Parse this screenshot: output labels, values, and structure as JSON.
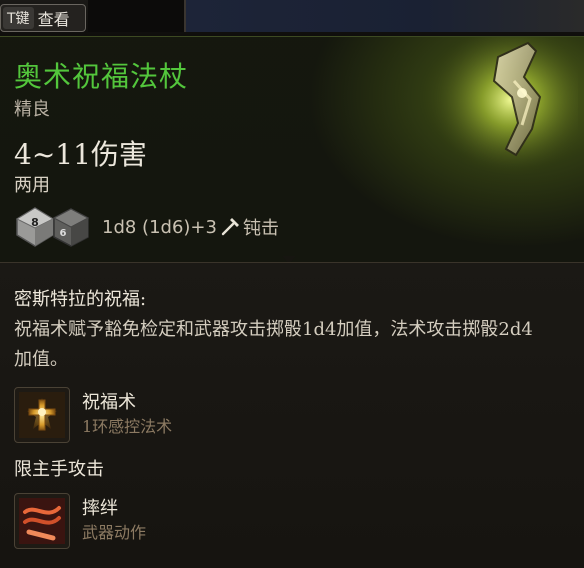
{
  "topbar": {
    "key": "T键",
    "label": "查看"
  },
  "item": {
    "name": "奥术祝福法杖",
    "rarity": "精良",
    "damage": "4~11伤害",
    "handedness": "两用",
    "dice_formula": "1d8 (1d6)+3",
    "damage_type": "钝击",
    "dice": [
      "8",
      "6"
    ]
  },
  "blessing": {
    "title": "密斯特拉的祝福:",
    "description": "祝福术赋予豁免检定和武器攻击掷骰1d4加值，法术攻击掷骰2d4加值。"
  },
  "abilities": {
    "spell": {
      "name": "祝福术",
      "subtitle": "1环感控法术"
    },
    "restriction": "限主手攻击",
    "action": {
      "name": "摔绊",
      "subtitle": "武器动作"
    }
  },
  "colors": {
    "title": "#53c63c",
    "subtitle": "#8c7a62"
  }
}
